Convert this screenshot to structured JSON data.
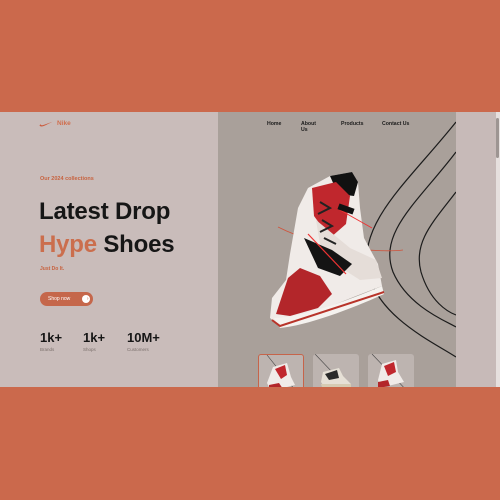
{
  "brand": {
    "name": "Nike"
  },
  "nav": {
    "items": [
      "Home",
      "About Us",
      "Products",
      "Contact Us"
    ]
  },
  "hero": {
    "subtitle": "Our 2024 collections",
    "headline_line1": "Latest Drop",
    "headline_accent": "Hype",
    "headline_rest": "Shoes",
    "tagline": "Just Do It.",
    "cta_label": "Shop now"
  },
  "stats": [
    {
      "value": "1k+",
      "label": "Brands"
    },
    {
      "value": "1k+",
      "label": "Shops"
    },
    {
      "value": "10M+",
      "label": "Customers"
    }
  ],
  "colors": {
    "accent": "#cb6e4d",
    "background_outer": "#cb694c",
    "left_panel": "#c9bcba",
    "right_panel": "#a9a09a"
  },
  "icons": {
    "brand_logo": "nike-swoosh-icon",
    "cta_icon": "arrow-right-icon"
  }
}
